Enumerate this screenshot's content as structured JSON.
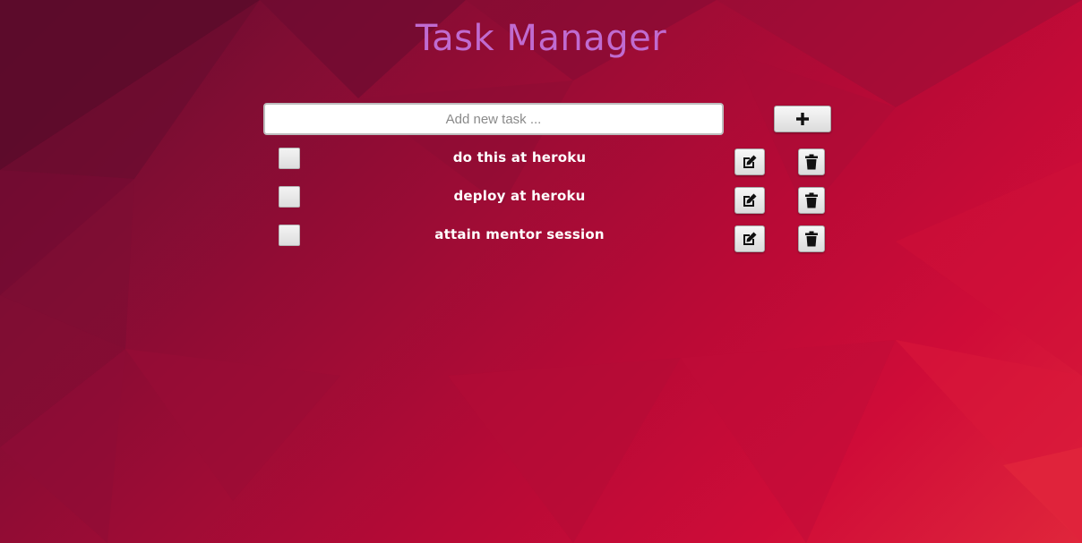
{
  "app": {
    "title": "Task Manager"
  },
  "new_task": {
    "placeholder": "Add new task ...",
    "value": "",
    "add_icon": "plus-icon"
  },
  "tasks": [
    {
      "text": "do this at heroku",
      "completed": false,
      "edit_icon": "edit-icon",
      "delete_icon": "trash-icon"
    },
    {
      "text": "deploy at heroku",
      "completed": false,
      "edit_icon": "edit-icon",
      "delete_icon": "trash-icon"
    },
    {
      "text": "attain mentor session",
      "completed": false,
      "edit_icon": "edit-icon",
      "delete_icon": "trash-icon"
    }
  ],
  "colors": {
    "title": "#c06bd0",
    "task_text": "#ffffff",
    "background_dark": "#5a0a2a",
    "background_light": "#e0263b"
  }
}
